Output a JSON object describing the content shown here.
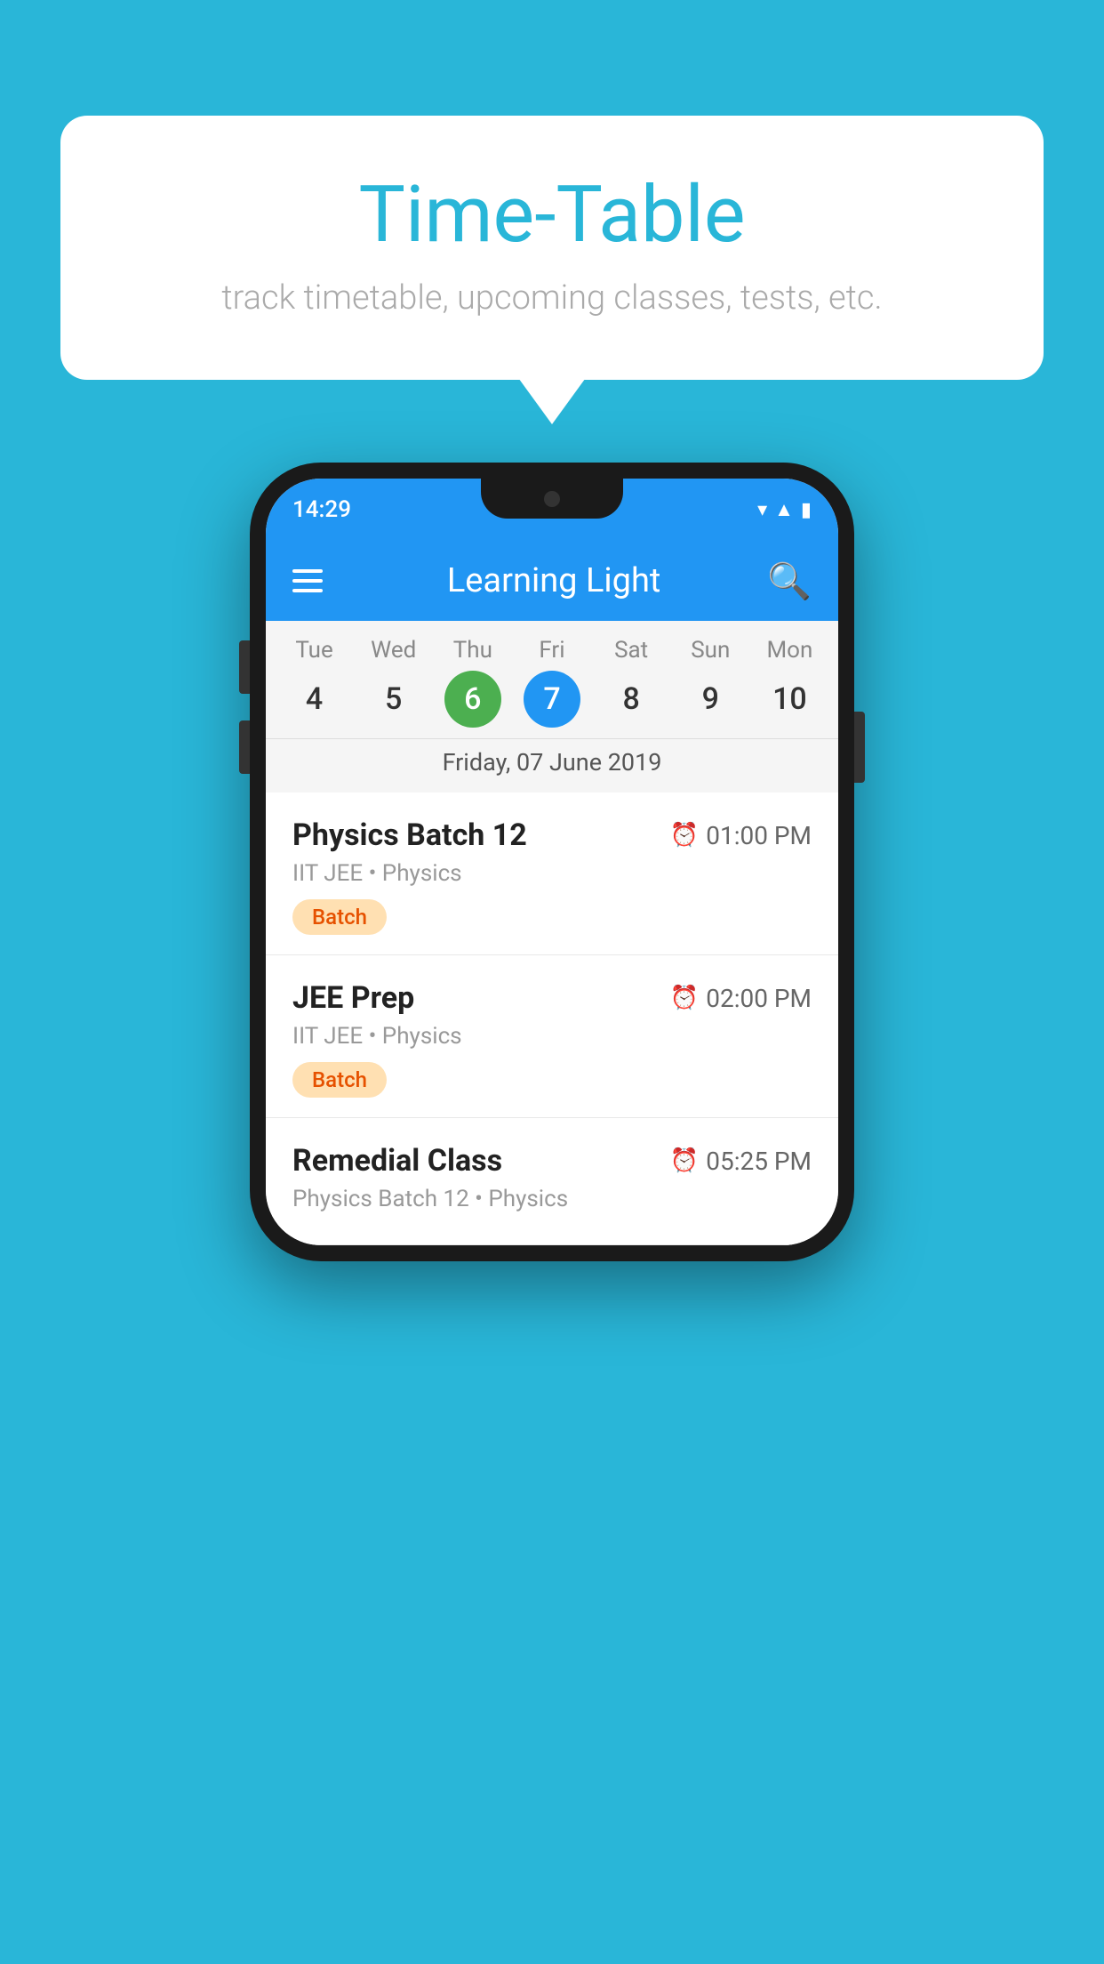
{
  "background_color": "#29b6d8",
  "bubble": {
    "title": "Time-Table",
    "subtitle": "track timetable, upcoming classes, tests, etc."
  },
  "phone": {
    "status_bar": {
      "time": "14:29"
    },
    "app_bar": {
      "title": "Learning Light"
    },
    "calendar": {
      "days": [
        {
          "label": "Tue",
          "number": "4",
          "state": "normal"
        },
        {
          "label": "Wed",
          "number": "5",
          "state": "normal"
        },
        {
          "label": "Thu",
          "number": "6",
          "state": "today"
        },
        {
          "label": "Fri",
          "number": "7",
          "state": "selected"
        },
        {
          "label": "Sat",
          "number": "8",
          "state": "normal"
        },
        {
          "label": "Sun",
          "number": "9",
          "state": "normal"
        },
        {
          "label": "Mon",
          "number": "10",
          "state": "normal"
        }
      ],
      "selected_date_label": "Friday, 07 June 2019"
    },
    "schedule": [
      {
        "title": "Physics Batch 12",
        "time": "01:00 PM",
        "subtitle": "IIT JEE • Physics",
        "tag": "Batch"
      },
      {
        "title": "JEE Prep",
        "time": "02:00 PM",
        "subtitle": "IIT JEE • Physics",
        "tag": "Batch"
      },
      {
        "title": "Remedial Class",
        "time": "05:25 PM",
        "subtitle": "Physics Batch 12 • Physics",
        "tag": ""
      }
    ]
  }
}
